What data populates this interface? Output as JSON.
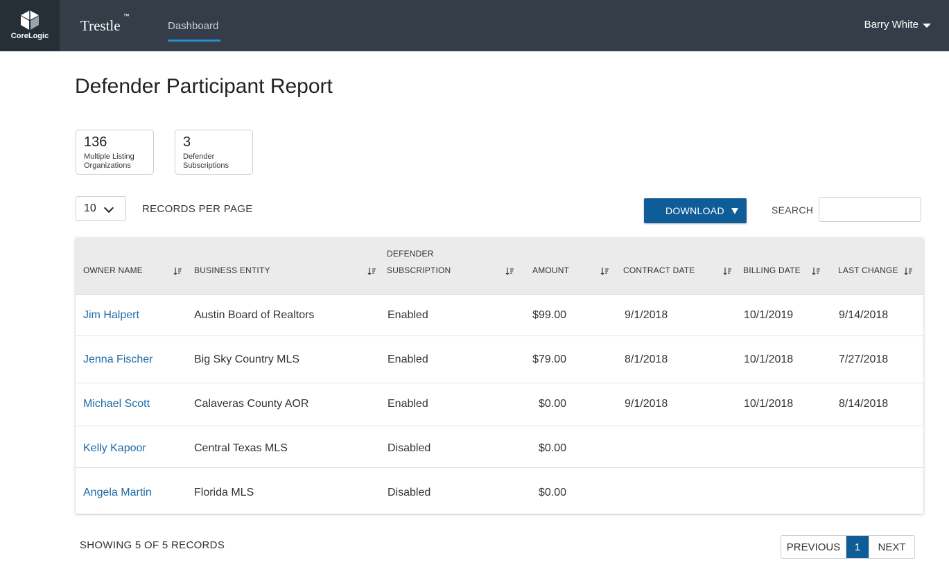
{
  "header": {
    "logo_text": "CoreLogic",
    "brand": "Trestle",
    "brand_tm": "™",
    "nav_item": "Dashboard",
    "user_name": "Barry White"
  },
  "page": {
    "title": "Defender Participant Report"
  },
  "stats": [
    {
      "value": "136",
      "label_line1": "Multiple Listing",
      "label_line2": "Organizations"
    },
    {
      "value": "3",
      "label_line1": "Defender",
      "label_line2": "Subscriptions"
    }
  ],
  "controls": {
    "per_page_value": "10",
    "per_page_label": "RECORDS PER PAGE",
    "download_label": "DOWNLOAD",
    "search_label": "SEARCH",
    "search_value": ""
  },
  "table": {
    "columns": [
      {
        "line1": "",
        "line2": "OWNER NAME"
      },
      {
        "line1": "",
        "line2": "BUSINESS ENTITY"
      },
      {
        "line1": "DEFENDER",
        "line2": "SUBSCRIPTION"
      },
      {
        "line1": "",
        "line2": "AMOUNT"
      },
      {
        "line1": "",
        "line2": "CONTRACT DATE"
      },
      {
        "line1": "",
        "line2": "BILLING DATE"
      },
      {
        "line1": "",
        "line2": "LAST CHANGE"
      }
    ],
    "rows": [
      {
        "owner": "Jim Halpert",
        "entity": "Austin Board of Realtors",
        "subscription": "Enabled",
        "amount": "$99.00",
        "contract": "9/1/2018",
        "billing": "10/1/2019",
        "last_change": "9/14/2018"
      },
      {
        "owner": "Jenna Fischer",
        "entity": "Big Sky Country MLS",
        "subscription": "Enabled",
        "amount": "$79.00",
        "contract": "8/1/2018",
        "billing": "10/1/2018",
        "last_change": "7/27/2018"
      },
      {
        "owner": "Michael Scott",
        "entity": "Calaveras County AOR",
        "subscription": "Enabled",
        "amount": "$0.00",
        "contract": "9/1/2018",
        "billing": "10/1/2018",
        "last_change": "8/14/2018"
      },
      {
        "owner": "Kelly Kapoor",
        "entity": "Central Texas MLS",
        "subscription": "Disabled",
        "amount": "$0.00",
        "contract": "",
        "billing": "",
        "last_change": ""
      },
      {
        "owner": "Angela Martin",
        "entity": "Florida MLS",
        "subscription": "Disabled",
        "amount": "$0.00",
        "contract": "",
        "billing": "",
        "last_change": ""
      }
    ]
  },
  "footer": {
    "showing": "SHOWING 5 OF 5 RECORDS",
    "prev": "PREVIOUS",
    "current_page": "1",
    "next": "NEXT"
  },
  "colors": {
    "nav_bg": "#353e48",
    "logo_bg": "#262e36",
    "accent": "#0f5d98",
    "link": "#1e6aa6"
  }
}
